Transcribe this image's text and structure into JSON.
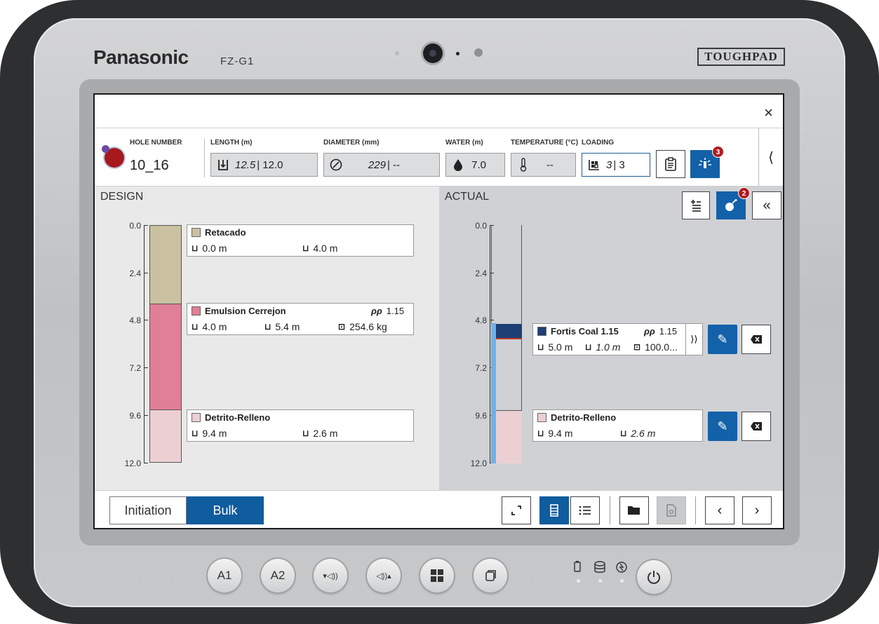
{
  "device": {
    "brand": "Panasonic",
    "model": "FZ-G1",
    "badge": "TOUGHPAD",
    "hw_buttons": [
      "A1",
      "A2",
      "▾◁))",
      "◁))▴"
    ]
  },
  "header": {
    "close_icon": "×"
  },
  "info": {
    "hole_label": "HOLE NUMBER",
    "hole_value": "10_16",
    "length_label": "LENGTH (m)",
    "length_design": "12.5",
    "length_actual": "| 12.0",
    "diameter_label": "DIAMETER (mm)",
    "diameter_design": "229",
    "diameter_actual": "| --",
    "water_label": "WATER (m)",
    "water_value": "7.0",
    "temperature_label": "TEMPERATURE (°C)",
    "temperature_value": "--",
    "loading_label": "LOADING",
    "loading_value": "3",
    "loading_actual": "| 3",
    "alert_badge": "3"
  },
  "design": {
    "title": "DESIGN",
    "axis": [
      "0.0",
      "2.4",
      "4.8",
      "7.2",
      "9.6",
      "12.0"
    ],
    "layers": [
      {
        "name": "Retacado",
        "color": "#c9c1a0",
        "from": "0.0 m",
        "length": "4.0 m"
      },
      {
        "name": "Emulsion Cerrejon",
        "color": "#e07f95",
        "from": "4.0 m",
        "length": "5.4 m",
        "weight": "254.6 kg",
        "density": "1.15"
      },
      {
        "name": "Detrito-Relleno",
        "color": "#ebcfd3",
        "from": "9.4 m",
        "length": "2.6 m"
      }
    ]
  },
  "actual": {
    "title": "ACTUAL",
    "axis": [
      "0.0",
      "2.4",
      "4.8",
      "7.2",
      "9.6",
      "12.0"
    ],
    "charge_badge": "2",
    "layers": [
      {
        "name": "Fortis Coal 1.15",
        "color": "#1d3f75",
        "from": "5.0 m",
        "length": "1.0 m",
        "weight": "100.0...",
        "density": "1.15"
      },
      {
        "name": "Detrito-Relleno",
        "color": "#ebcfd3",
        "from": "9.4 m",
        "length": "2.6 m"
      }
    ]
  },
  "bottom": {
    "tab_initiation": "Initiation",
    "tab_bulk": "Bulk"
  },
  "colors": {
    "accent": "#0f5c9e",
    "alert": "#b21a1f"
  }
}
